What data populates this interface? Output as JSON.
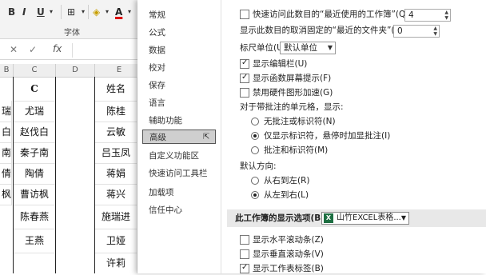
{
  "ribbon": {
    "bold": "B",
    "italic": "I",
    "underline": "U",
    "font_color_letter": "A",
    "group_label": "字体"
  },
  "formula_bar": {
    "fx": "fx"
  },
  "sheet": {
    "col_headers": [
      "B",
      "C",
      "D",
      "E"
    ],
    "col_c_header_text": "C",
    "col_b_cells": [
      "瑞",
      "白",
      "南",
      "倩",
      "枫"
    ],
    "col_c_cells": [
      "尤瑞",
      "赵伐白",
      "秦子南",
      "陶倩",
      "曹访枫",
      "陈春燕",
      "王燕"
    ],
    "col_e_cells": [
      "姓名",
      "陈桂",
      "云敏",
      "吕玉凤",
      "蒋娟",
      "蒋兴",
      "施瑞进",
      "卫娅",
      "许莉"
    ]
  },
  "nav": {
    "items": [
      "常规",
      "公式",
      "数据",
      "校对",
      "保存",
      "语言",
      "辅助功能",
      "高级",
      "自定义功能区",
      "快速访问工具栏",
      "加载项",
      "信任中心"
    ],
    "active_index": 7
  },
  "panel": {
    "recent_workbooks_label": "快速访问此数目的“最近使用的工作簿”(Q):",
    "recent_workbooks_value": "4",
    "unpinned_folders_label": "显示此数目的取消固定的“最近的文件夹”(F):",
    "unpinned_folders_value": "0",
    "ruler_units_label": "标尺单位(U)",
    "ruler_units_value": "默认单位",
    "show_formula_bar": "显示编辑栏(U)",
    "show_function_tips": "显示函数屏幕提示(F)",
    "disable_hw_accel": "禁用硬件图形加速(G)",
    "comments_header": "对于带批注的单元格，显示:",
    "no_comments": "无批注或标识符(N)",
    "indicators_only": "仅显示标识符，悬停时加显批注(I)",
    "comments_and_indicators": "批注和标识符(M)",
    "direction_header": "默认方向:",
    "right_to_left": "从右到左(R)",
    "left_to_right": "从左到右(L)",
    "section_title": "此工作簿的显示选项(B):",
    "workbook_select": "山竹EXCEL表格...",
    "show_h_scroll": "显示水平滚动条(Z)",
    "show_v_scroll": "显示垂直滚动条(V)",
    "show_sheet_tabs": "显示工作表标签(B)"
  },
  "colors": {
    "excel_green": "#1d6f42",
    "nav_active_bg": "#cfcfcf"
  },
  "icons": [
    "close-icon",
    "check-icon",
    "fx-icon",
    "fill-color-icon",
    "font-color-icon",
    "chevron-down-icon",
    "excel-logo-icon",
    "cursor-icon"
  ]
}
